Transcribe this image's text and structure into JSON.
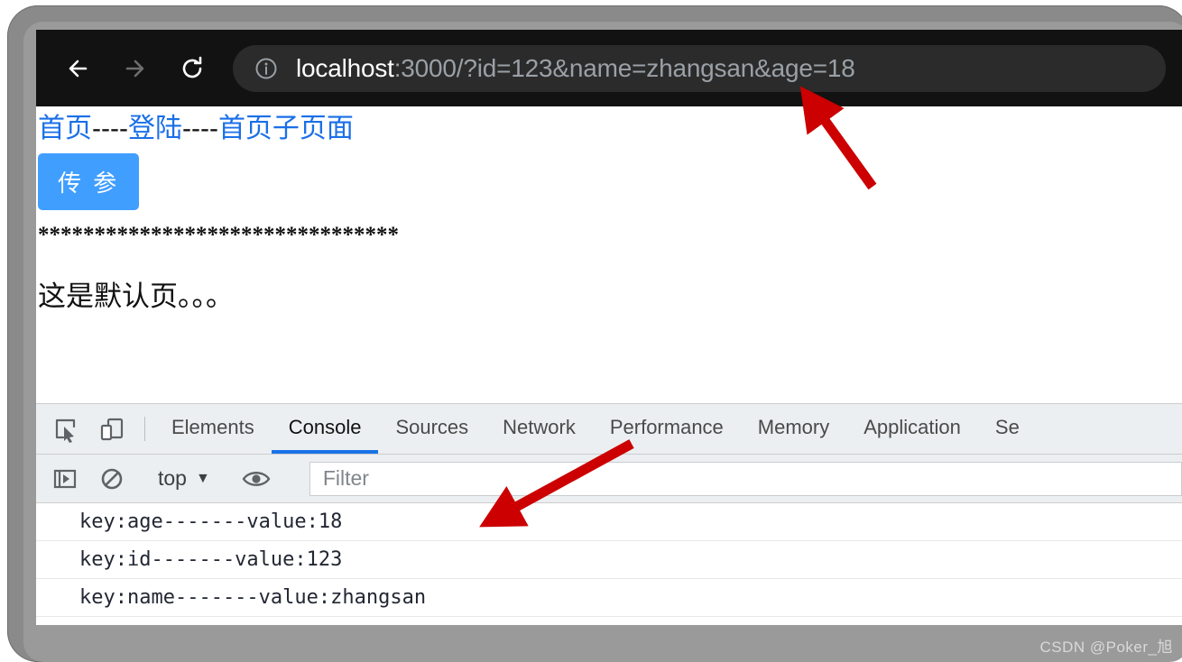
{
  "browser": {
    "back_label": "back-arrow",
    "forward_label": "forward-arrow",
    "reload_label": "reload",
    "url_host": "localhost",
    "url_rest": ":3000/?id=123&name=zhangsan&age=18",
    "site_info_label": "site-information"
  },
  "page": {
    "links": [
      {
        "label": "首页"
      },
      {
        "label": "登陆"
      },
      {
        "label": "首页子页面"
      }
    ],
    "link_separator": "----",
    "button_label": "传 参",
    "stars": "********************************",
    "default_text": "这是默认页。。。"
  },
  "devtools": {
    "tabs": [
      {
        "label": "Elements",
        "active": false
      },
      {
        "label": "Console",
        "active": true
      },
      {
        "label": "Sources",
        "active": false
      },
      {
        "label": "Network",
        "active": false
      },
      {
        "label": "Performance",
        "active": false
      },
      {
        "label": "Memory",
        "active": false
      },
      {
        "label": "Application",
        "active": false
      },
      {
        "label": "Se",
        "active": false
      }
    ],
    "console_toolbar": {
      "context": "top",
      "caret": "▼",
      "filter_placeholder": "Filter"
    },
    "console_messages": [
      "key:age-------value:18",
      "key:id-------value:123",
      "key:name-------value:zhangsan"
    ],
    "prompt_symbol": ">"
  },
  "watermark": "CSDN @Poker_旭",
  "colors": {
    "accent_blue": "#409eff",
    "link_blue": "#1a6fe8",
    "tab_active": "#1a73e8",
    "arrow_red": "#cc0000",
    "chrome_bg": "#121212",
    "omnibox_bg": "#2b2b2b",
    "devtools_bg": "#eceff1",
    "frame_gray": "#8a8a8a"
  }
}
